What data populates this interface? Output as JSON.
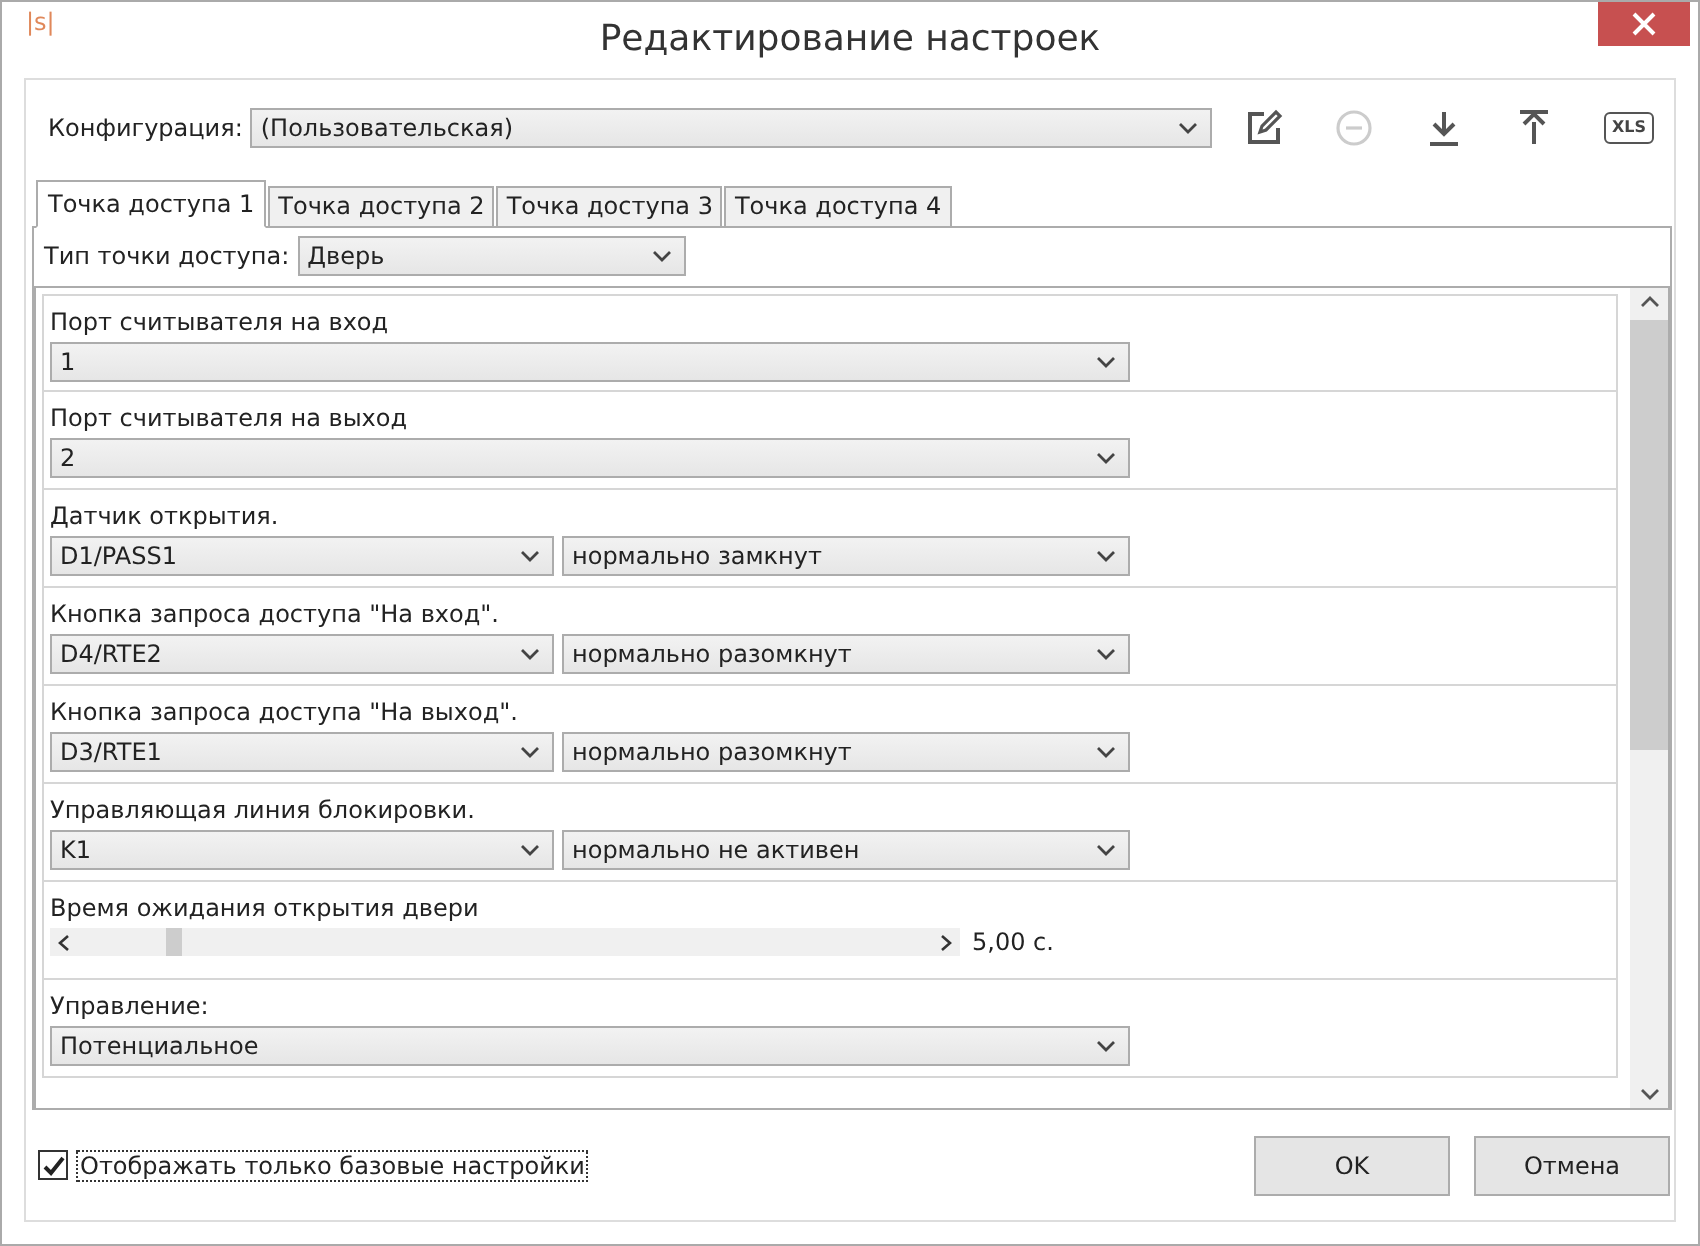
{
  "window": {
    "title": "Редактирование настроек",
    "logo": "|s|"
  },
  "config": {
    "label": "Конфигурация:",
    "value": "(Пользовательская)",
    "xls": "XLS",
    "delete_disabled": true
  },
  "tabs": [
    {
      "label": "Точка доступа 1",
      "selected": true
    },
    {
      "label": "Точка доступа 2",
      "selected": false
    },
    {
      "label": "Точка доступа 3",
      "selected": false
    },
    {
      "label": "Точка доступа 4",
      "selected": false
    }
  ],
  "access_point_type": {
    "label": "Тип точки доступа:",
    "value": "Дверь"
  },
  "settings": [
    {
      "kind": "select",
      "label": "Порт считывателя на вход",
      "values": [
        "1"
      ]
    },
    {
      "kind": "select",
      "label": "Порт считывателя на выход",
      "values": [
        "2"
      ]
    },
    {
      "kind": "select",
      "label": "Датчик открытия.",
      "values": [
        "D1/PASS1",
        "нормально замкнут"
      ]
    },
    {
      "kind": "select",
      "label": "Кнопка запроса доступа \"На вход\".",
      "values": [
        "D4/RTE2",
        "нормально разомкнут"
      ]
    },
    {
      "kind": "select",
      "label": "Кнопка запроса доступа \"На выход\".",
      "values": [
        "D3/RTE1",
        "нормально разомкнут"
      ]
    },
    {
      "kind": "select",
      "label": "Управляющая линия блокировки.",
      "values": [
        "K1",
        "нормально не активен"
      ]
    },
    {
      "kind": "slider",
      "label": "Время ожидания открытия двери",
      "level": 0.1,
      "reading": "5,00 с."
    },
    {
      "kind": "select",
      "label": "Управление:",
      "values": [
        "Потенциальное"
      ]
    }
  ],
  "footer": {
    "checkbox": {
      "label": "Отображать только базовые настройки",
      "checked": true
    },
    "buttons": [
      "OK",
      "Отмена"
    ]
  }
}
